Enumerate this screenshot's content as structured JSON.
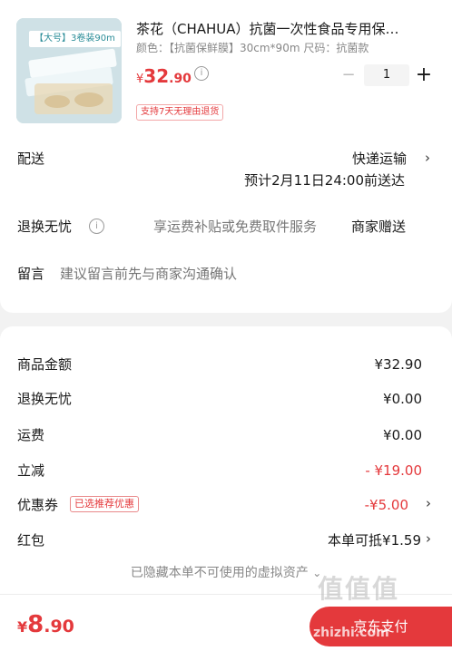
{
  "product": {
    "thumb_badge": "【大号】3卷装90m",
    "title": "茶花（CHAHUA）抗菌一次性食品专用保…",
    "spec": "颜色：【抗菌保鲜膜】30cm*90m   尺码：抗菌款",
    "price_symbol": "¥",
    "price_int": "32",
    "price_dec": ".90",
    "quantity": "1",
    "return_badge": "支持7天无理由退货"
  },
  "delivery": {
    "label": "配送",
    "method": "快递运输",
    "estimate": "预计2月11日24:00前送达"
  },
  "return_service": {
    "label": "退换无忧",
    "text": "享运费补贴或免费取件服务",
    "gift": "商家赠送"
  },
  "message": {
    "label": "留言",
    "placeholder": "建议留言前先与商家沟通确认"
  },
  "summary": {
    "goods_label": "商品金额",
    "goods_value": "¥32.90",
    "return_label": "退换无忧",
    "return_value": "¥0.00",
    "shipping_label": "运费",
    "shipping_value": "¥0.00",
    "discount_label": "立减",
    "discount_value": "- ¥19.00",
    "coupon_label": "优惠券",
    "coupon_tag": "已选推荐优惠",
    "coupon_value": "-¥5.00",
    "redpack_label": "红包",
    "redpack_value": "本单可抵¥1.59",
    "hidden_note": "已隐藏本单不可使用的虚拟资产"
  },
  "footer": {
    "total_symbol": "¥",
    "total_int": "8",
    "total_dec": ".90",
    "pay_label": "京东支付"
  },
  "watermark": {
    "text": "值值值",
    "site": "zhizhi.com"
  },
  "colors": {
    "accent": "#e4393c",
    "background": "#f2f2f2"
  }
}
